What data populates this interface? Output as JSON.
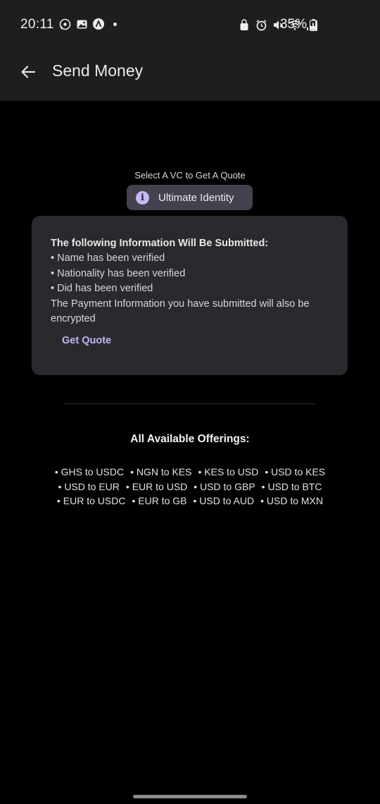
{
  "status_bar": {
    "time": "20:11",
    "battery": "35%",
    "icons_left": [
      "whatsapp-icon",
      "gallery-icon",
      "app-icon",
      "dot-icon"
    ],
    "icons_right": [
      "alarm-icon",
      "mute-icon",
      "wifi-icon",
      "signal-icon",
      "battery-icon"
    ]
  },
  "appbar": {
    "title": "Send Money"
  },
  "vc": {
    "select_label": "Select A VC to Get A Quote",
    "chip_label": "Ultimate Identity",
    "chip_icon": "info-icon"
  },
  "card": {
    "title": "The following Information Will Be Submitted:",
    "items": [
      "• Name has been verified",
      "• Nationality has been verified",
      "• Did has been verified"
    ],
    "note_line1": "The Payment Information you have submitted will also be",
    "note_line2": "encrypted",
    "action": "Get Quote"
  },
  "offerings": {
    "title": "All Available Offerings:",
    "rows": [
      [
        "• GHS to USDC",
        "• NGN to KES",
        "• KES to USD",
        "• USD to KES"
      ],
      [
        "• USD to EUR",
        "• EUR to USD",
        "• USD to GBP",
        "• USD to BTC"
      ],
      [
        "• EUR to USDC",
        "• EUR to GB",
        "• USD to AUD",
        "• USD to MXN"
      ]
    ]
  },
  "colors": {
    "background": "#000000",
    "bar": "#1e1e20",
    "card": "#2a2a2e",
    "chip": "#45424f",
    "accent": "#c5b6f5"
  }
}
